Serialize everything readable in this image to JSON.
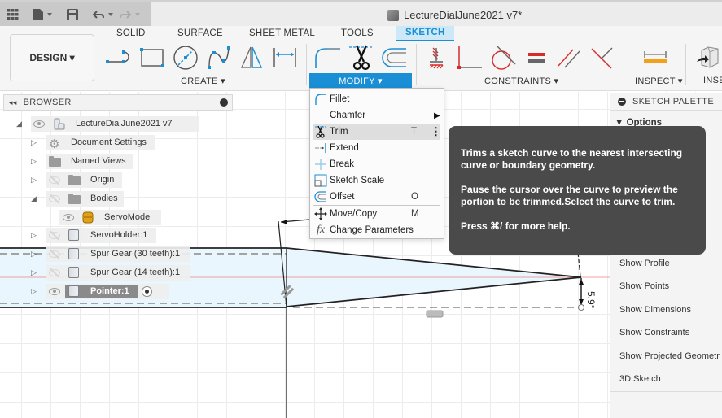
{
  "app": {
    "document_title": "LectureDialJune2021 v7*",
    "workspace_button": "DESIGN ▾"
  },
  "quick_access": {
    "icons": [
      "grid-menu-icon",
      "file-icon",
      "save-icon",
      "undo-icon",
      "redo-icon"
    ]
  },
  "ribbon": {
    "tabs": [
      {
        "label": "SOLID",
        "active": false
      },
      {
        "label": "SURFACE",
        "active": false
      },
      {
        "label": "SHEET METAL",
        "active": false
      },
      {
        "label": "TOOLS",
        "active": false
      },
      {
        "label": "SKETCH",
        "active": true
      }
    ],
    "groups": {
      "create": "CREATE ▾",
      "modify": "MODIFY ▾",
      "constraints": "CONSTRAINTS ▾",
      "inspect": "INSPECT ▾",
      "insert": "INSE"
    },
    "accent_color": "#1a8fd6"
  },
  "browser": {
    "title": "BROWSER",
    "items": [
      {
        "label": "LectureDialJune2021 v7",
        "expanded": true,
        "visible": true
      },
      {
        "label": "Document Settings",
        "expanded": false
      },
      {
        "label": "Named Views",
        "expanded": false
      },
      {
        "label": "Origin",
        "expanded": false,
        "visible": false
      },
      {
        "label": "Bodies",
        "expanded": true,
        "visible": false
      },
      {
        "label": "ServoModel",
        "visible": true
      },
      {
        "label": "ServoHolder:1",
        "expanded": false,
        "visible": false
      },
      {
        "label": "Spur Gear (30 teeth):1",
        "expanded": false,
        "visible": false
      },
      {
        "label": "Spur Gear (14 teeth):1",
        "expanded": false,
        "visible": false
      },
      {
        "label": "Pointer:1",
        "expanded": false,
        "visible": true,
        "active": true
      }
    ]
  },
  "modify_menu": {
    "items": [
      {
        "label": "Fillet",
        "shortcut": ""
      },
      {
        "label": "Chamfer",
        "shortcut": "",
        "submenu": true
      },
      {
        "label": "Trim",
        "shortcut": "T",
        "highlighted": true
      },
      {
        "label": "Extend",
        "shortcut": ""
      },
      {
        "label": "Break",
        "shortcut": ""
      },
      {
        "label": "Sketch Scale",
        "shortcut": ""
      },
      {
        "label": "Offset",
        "shortcut": "O"
      },
      {
        "label": "Move/Copy",
        "shortcut": "M"
      },
      {
        "label": "Change Parameters",
        "shortcut": ""
      }
    ]
  },
  "tooltip": {
    "line1": "Trims a sketch curve to the nearest intersecting curve or boundary geometry.",
    "line2": "Pause the cursor over the curve to preview the portion to be trimmed.Select the curve to trim.",
    "line3": "Press ⌘/ for more help."
  },
  "sketch_palette": {
    "title": "SKETCH PALETTE",
    "section": "▼ Options",
    "items": [
      "Show Profile",
      "Show Points",
      "Show Dimensions",
      "Show Constraints",
      "Show Projected Geometr",
      "3D Sketch"
    ]
  },
  "sketch": {
    "dimension_label": "5.9°"
  }
}
